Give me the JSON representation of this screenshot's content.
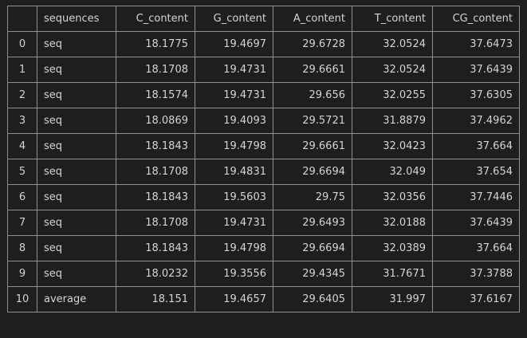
{
  "table": {
    "columns": [
      "",
      "sequences",
      "C_content",
      "G_content",
      "A_content",
      "T_content",
      "CG_content"
    ],
    "rows": [
      {
        "index": "0",
        "sequences": "seq",
        "C_content": "18.1775",
        "G_content": "19.4697",
        "A_content": "29.6728",
        "T_content": "32.0524",
        "CG_content": "37.6473"
      },
      {
        "index": "1",
        "sequences": "seq",
        "C_content": "18.1708",
        "G_content": "19.4731",
        "A_content": "29.6661",
        "T_content": "32.0524",
        "CG_content": "37.6439"
      },
      {
        "index": "2",
        "sequences": "seq",
        "C_content": "18.1574",
        "G_content": "19.4731",
        "A_content": "29.656",
        "T_content": "32.0255",
        "CG_content": "37.6305"
      },
      {
        "index": "3",
        "sequences": "seq",
        "C_content": "18.0869",
        "G_content": "19.4093",
        "A_content": "29.5721",
        "T_content": "31.8879",
        "CG_content": "37.4962"
      },
      {
        "index": "4",
        "sequences": "seq",
        "C_content": "18.1843",
        "G_content": "19.4798",
        "A_content": "29.6661",
        "T_content": "32.0423",
        "CG_content": "37.664"
      },
      {
        "index": "5",
        "sequences": "seq",
        "C_content": "18.1708",
        "G_content": "19.4831",
        "A_content": "29.6694",
        "T_content": "32.049",
        "CG_content": "37.654"
      },
      {
        "index": "6",
        "sequences": "seq",
        "C_content": "18.1843",
        "G_content": "19.5603",
        "A_content": "29.75",
        "T_content": "32.0356",
        "CG_content": "37.7446"
      },
      {
        "index": "7",
        "sequences": "seq",
        "C_content": "18.1708",
        "G_content": "19.4731",
        "A_content": "29.6493",
        "T_content": "32.0188",
        "CG_content": "37.6439"
      },
      {
        "index": "8",
        "sequences": "seq",
        "C_content": "18.1843",
        "G_content": "19.4798",
        "A_content": "29.6694",
        "T_content": "32.0389",
        "CG_content": "37.664"
      },
      {
        "index": "9",
        "sequences": "seq",
        "C_content": "18.0232",
        "G_content": "19.3556",
        "A_content": "29.4345",
        "T_content": "31.7671",
        "CG_content": "37.3788"
      },
      {
        "index": "10",
        "sequences": "average",
        "C_content": "18.151",
        "G_content": "19.4657",
        "A_content": "29.6405",
        "T_content": "31.997",
        "CG_content": "37.6167"
      }
    ]
  }
}
